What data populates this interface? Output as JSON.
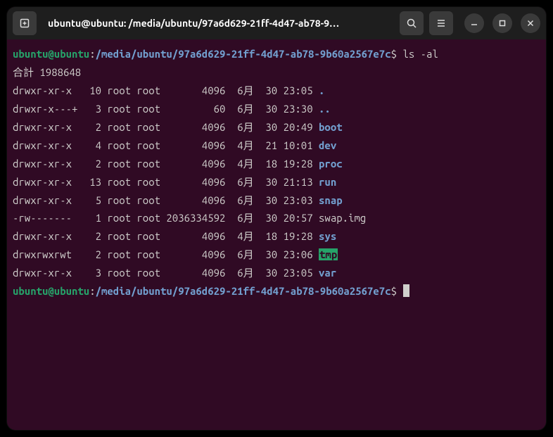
{
  "titlebar": {
    "title": "ubuntu@ubuntu: /media/ubuntu/97a6d629-21ff-4d47-ab78-9…"
  },
  "prompt": {
    "user_host": "ubuntu@ubuntu",
    "separator": ":",
    "path": "/media/ubuntu/97a6d629-21ff-4d47-ab78-9b60a2567e7c",
    "symbol": "$"
  },
  "command": "ls -al",
  "total_line": "合計 1988648",
  "listing": [
    {
      "perms": "drwxr-xr-x",
      "links": "10",
      "owner": "root",
      "group": "root",
      "size": "4096",
      "date": "6月  30 23:05",
      "name": ".",
      "cls": "dir-dot"
    },
    {
      "perms": "drwxr-x---+",
      "links": "3",
      "owner": "root",
      "group": "root",
      "size": "60",
      "date": "6月  30 23:30",
      "name": "..",
      "cls": "dir-dot"
    },
    {
      "perms": "drwxr-xr-x",
      "links": "2",
      "owner": "root",
      "group": "root",
      "size": "4096",
      "date": "6月  30 20:49",
      "name": "boot",
      "cls": "dir"
    },
    {
      "perms": "drwxr-xr-x",
      "links": "4",
      "owner": "root",
      "group": "root",
      "size": "4096",
      "date": "4月  21 10:01",
      "name": "dev",
      "cls": "dir"
    },
    {
      "perms": "drwxr-xr-x",
      "links": "2",
      "owner": "root",
      "group": "root",
      "size": "4096",
      "date": "4月  18 19:28",
      "name": "proc",
      "cls": "dir"
    },
    {
      "perms": "drwxr-xr-x",
      "links": "13",
      "owner": "root",
      "group": "root",
      "size": "4096",
      "date": "6月  30 21:13",
      "name": "run",
      "cls": "dir"
    },
    {
      "perms": "drwxr-xr-x",
      "links": "5",
      "owner": "root",
      "group": "root",
      "size": "4096",
      "date": "6月  30 23:03",
      "name": "snap",
      "cls": "dir"
    },
    {
      "perms": "-rw-------",
      "links": "1",
      "owner": "root",
      "group": "root",
      "size": "2036334592",
      "date": "6月  30 20:57",
      "name": "swap.img",
      "cls": ""
    },
    {
      "perms": "drwxr-xr-x",
      "links": "2",
      "owner": "root",
      "group": "root",
      "size": "4096",
      "date": "4月  18 19:28",
      "name": "sys",
      "cls": "dir"
    },
    {
      "perms": "drwxrwxrwt",
      "links": "2",
      "owner": "root",
      "group": "root",
      "size": "4096",
      "date": "6月  30 23:06",
      "name": "tmp",
      "cls": "sticky"
    },
    {
      "perms": "drwxr-xr-x",
      "links": "3",
      "owner": "root",
      "group": "root",
      "size": "4096",
      "date": "6月  30 23:05",
      "name": "var",
      "cls": "dir"
    }
  ]
}
